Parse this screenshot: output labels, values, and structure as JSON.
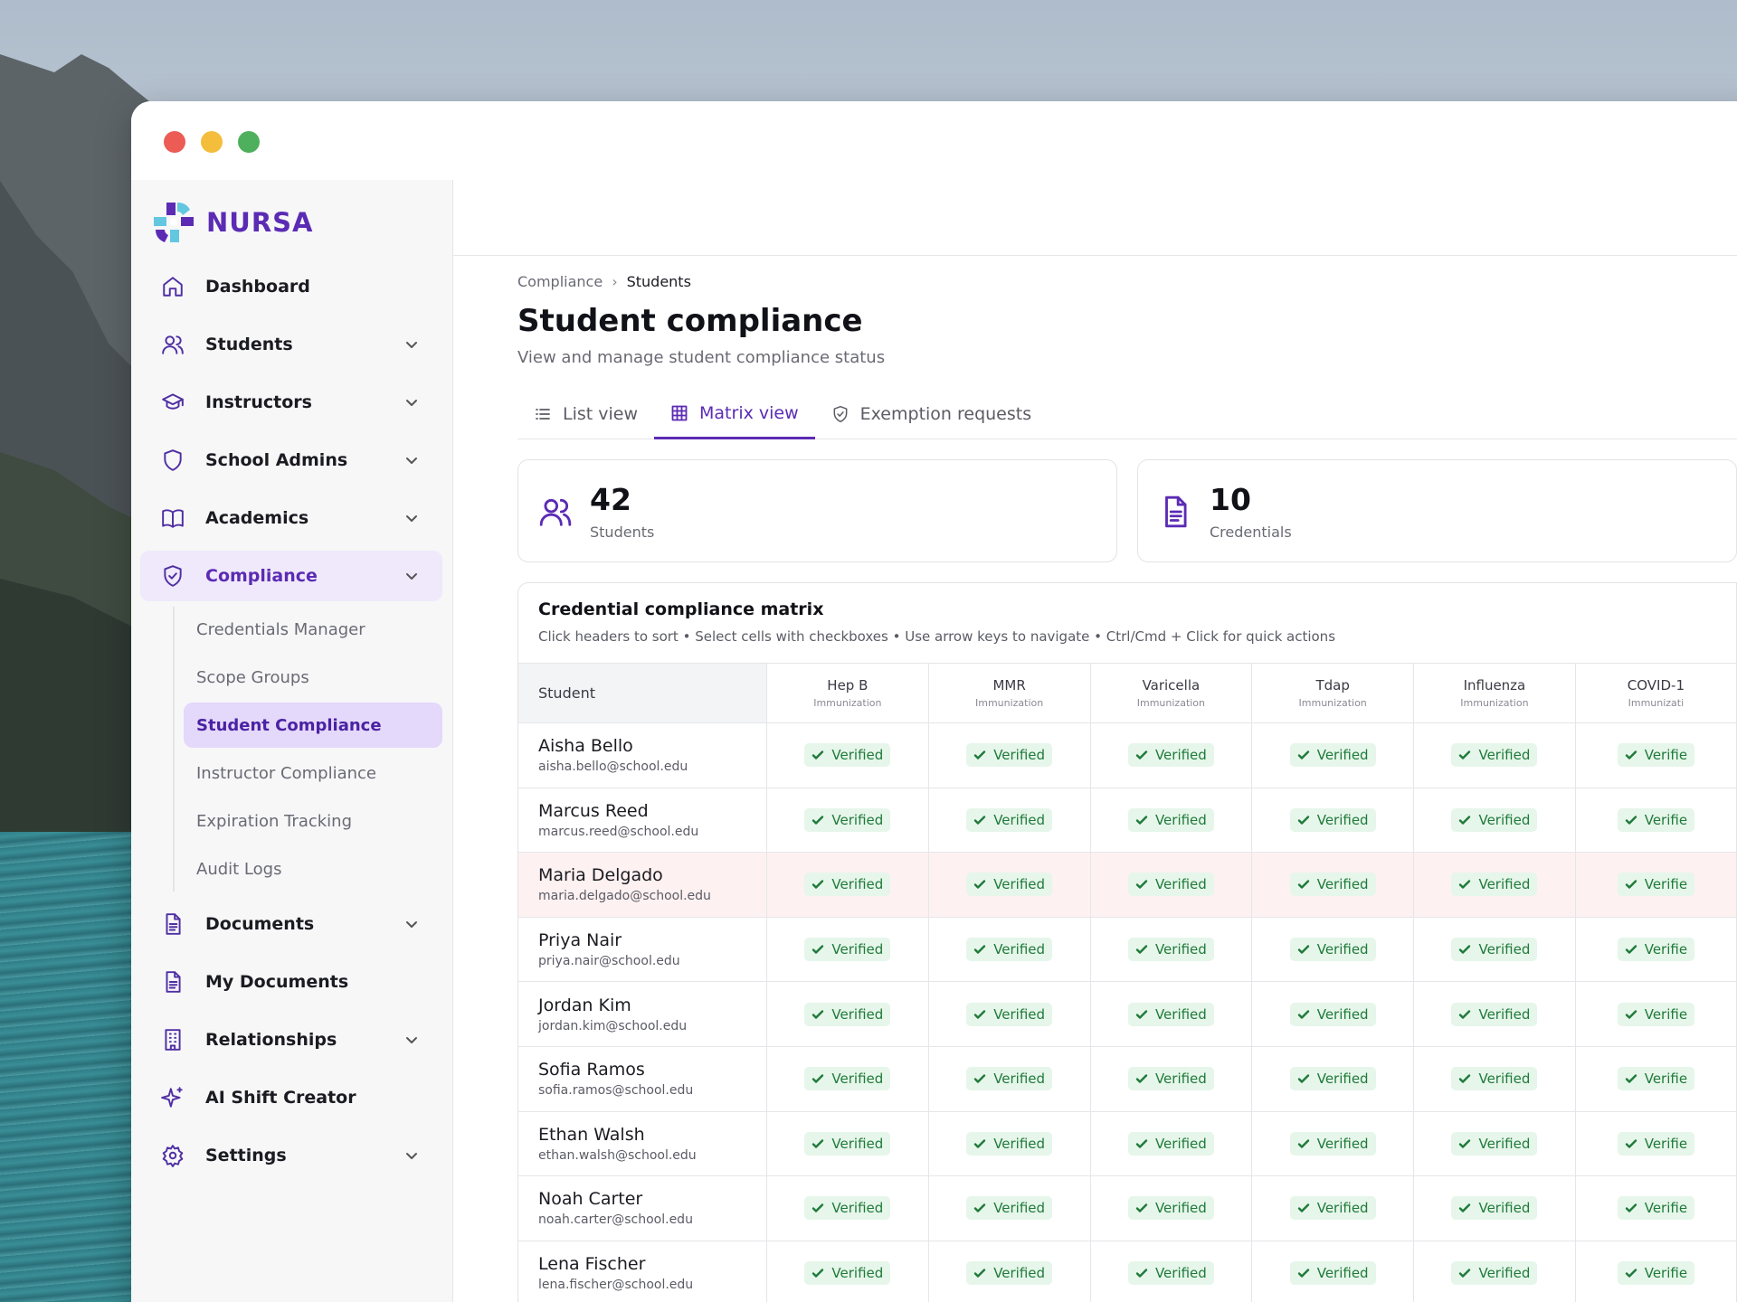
{
  "brand": {
    "name": "NURSA"
  },
  "sidebar": {
    "items": [
      {
        "label": "Dashboard",
        "icon": "home-icon",
        "expandable": false
      },
      {
        "label": "Students",
        "icon": "users-icon",
        "expandable": true
      },
      {
        "label": "Instructors",
        "icon": "graduation-cap-icon",
        "expandable": true
      },
      {
        "label": "School Admins",
        "icon": "shield-icon",
        "expandable": true
      },
      {
        "label": "Academics",
        "icon": "book-icon",
        "expandable": true
      },
      {
        "label": "Compliance",
        "icon": "shield-check-icon",
        "expandable": true,
        "active": true
      }
    ],
    "compliance_sub": [
      {
        "label": "Credentials Manager"
      },
      {
        "label": "Scope Groups"
      },
      {
        "label": "Student Compliance",
        "active": true
      },
      {
        "label": "Instructor Compliance"
      },
      {
        "label": "Expiration Tracking"
      },
      {
        "label": "Audit Logs"
      }
    ],
    "items_after": [
      {
        "label": "Documents",
        "icon": "document-icon",
        "expandable": true
      },
      {
        "label": "My Documents",
        "icon": "document-icon",
        "expandable": false
      },
      {
        "label": "Relationships",
        "icon": "building-icon",
        "expandable": true
      },
      {
        "label": "AI Shift Creator",
        "icon": "sparkles-icon",
        "expandable": false
      },
      {
        "label": "Settings",
        "icon": "gear-icon",
        "expandable": true
      }
    ]
  },
  "breadcrumb": {
    "parent": "Compliance",
    "current": "Students"
  },
  "page": {
    "title": "Student compliance",
    "subtitle": "View and manage student compliance status"
  },
  "tabs": [
    {
      "label": "List view",
      "icon": "list-icon"
    },
    {
      "label": "Matrix view",
      "icon": "grid-icon",
      "active": true
    },
    {
      "label": "Exemption requests",
      "icon": "shield-check-icon"
    }
  ],
  "stats": [
    {
      "value": "42",
      "label": "Students",
      "icon": "users-icon"
    },
    {
      "value": "10",
      "label": "Credentials",
      "icon": "document-icon"
    }
  ],
  "matrix": {
    "title": "Credential compliance matrix",
    "hint": "Click headers to sort • Select cells with checkboxes • Use arrow keys to navigate • Ctrl/Cmd + Click for quick actions",
    "student_header": "Student",
    "credentials": [
      {
        "name": "Hep B",
        "type": "Immunization"
      },
      {
        "name": "MMR",
        "type": "Immunization"
      },
      {
        "name": "Varicella",
        "type": "Immunization"
      },
      {
        "name": "Tdap",
        "type": "Immunization"
      },
      {
        "name": "Influenza",
        "type": "Immunization"
      },
      {
        "name": "COVID-1",
        "type": "Immunizati"
      }
    ],
    "status_label": "Verified",
    "students": [
      {
        "name": "Aisha Bello",
        "email": "aisha.bello@school.edu"
      },
      {
        "name": "Marcus Reed",
        "email": "marcus.reed@school.edu"
      },
      {
        "name": "Maria Delgado",
        "email": "maria.delgado@school.edu",
        "highlight": true
      },
      {
        "name": "Priya Nair",
        "email": "priya.nair@school.edu"
      },
      {
        "name": "Jordan Kim",
        "email": "jordan.kim@school.edu"
      },
      {
        "name": "Sofia Ramos",
        "email": "sofia.ramos@school.edu"
      },
      {
        "name": "Ethan Walsh",
        "email": "ethan.walsh@school.edu"
      },
      {
        "name": "Noah Carter",
        "email": "noah.carter@school.edu"
      },
      {
        "name": "Lena Fischer",
        "email": "lena.fischer@school.edu"
      }
    ],
    "last_column_visible_label": "Verifie"
  },
  "colors": {
    "accent": "#5b2bb4",
    "active_bg": "#efe9fb",
    "verified_bg": "#e6f6ea",
    "verified_text": "#1f7a3a",
    "highlight_row": "#fdf1f1"
  }
}
